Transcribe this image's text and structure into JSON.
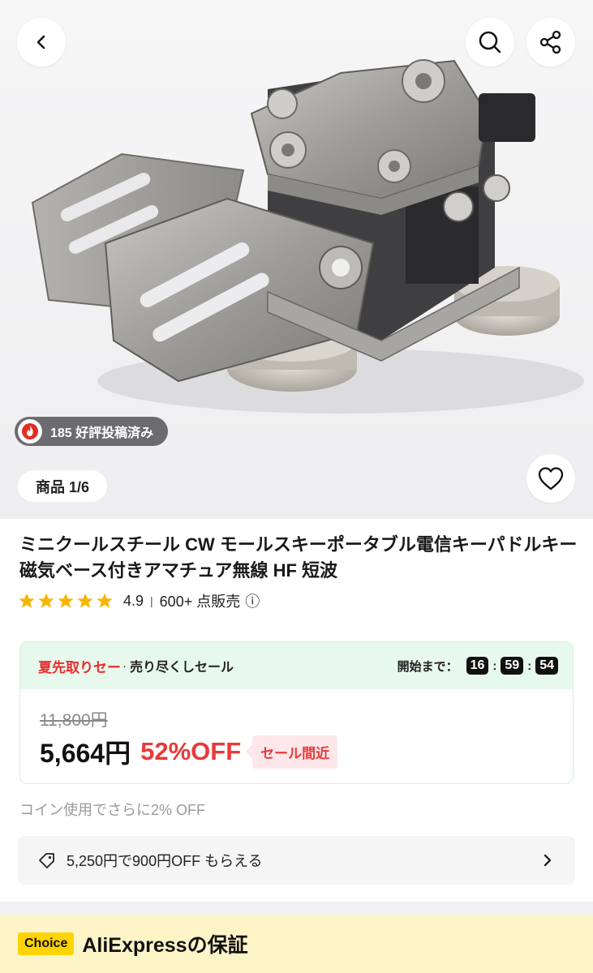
{
  "hero": {
    "review_badge": "185 好評投稿済み",
    "image_counter": "商品 1/6"
  },
  "icons": {
    "back": "chevron-left-icon",
    "search": "search-icon",
    "share": "share-icon",
    "favorite": "heart-icon",
    "flame": "flame-icon",
    "coupon": "tag-icon",
    "chevron": "chevron-right-icon"
  },
  "product": {
    "title": "ミニクールスチール CW モールスキーポータブル電信キーパドルキー磁気ベース付きアマチュア無線 HF 短波",
    "rating": "4.9",
    "rating_stars": 5,
    "sold": "600+ 点販売",
    "info_symbol": "ⓘ"
  },
  "sale": {
    "tag": "夏先取りセー",
    "dot": "·",
    "subtitle": "売り尽くしセール",
    "countdown_label": "開始まで：",
    "hours": "16",
    "minutes": "59",
    "seconds": "54",
    "separator": ":",
    "original_price": "11,800円",
    "price": "5,664円",
    "discount": "52%OFF",
    "badge": "セール間近"
  },
  "coin_note": "コイン使用でさらに2% OFF",
  "coupon": {
    "text": "5,250円で900円OFF もらえる"
  },
  "choice": {
    "badge": "Choice",
    "title": "AliExpressの保証"
  },
  "colors": {
    "sale_red": "#e62e2e",
    "sale_bg": "#e7f8ec",
    "choice_yellow": "#ffd400",
    "choice_bg": "#fdf4c8",
    "star": "#f7b500"
  }
}
